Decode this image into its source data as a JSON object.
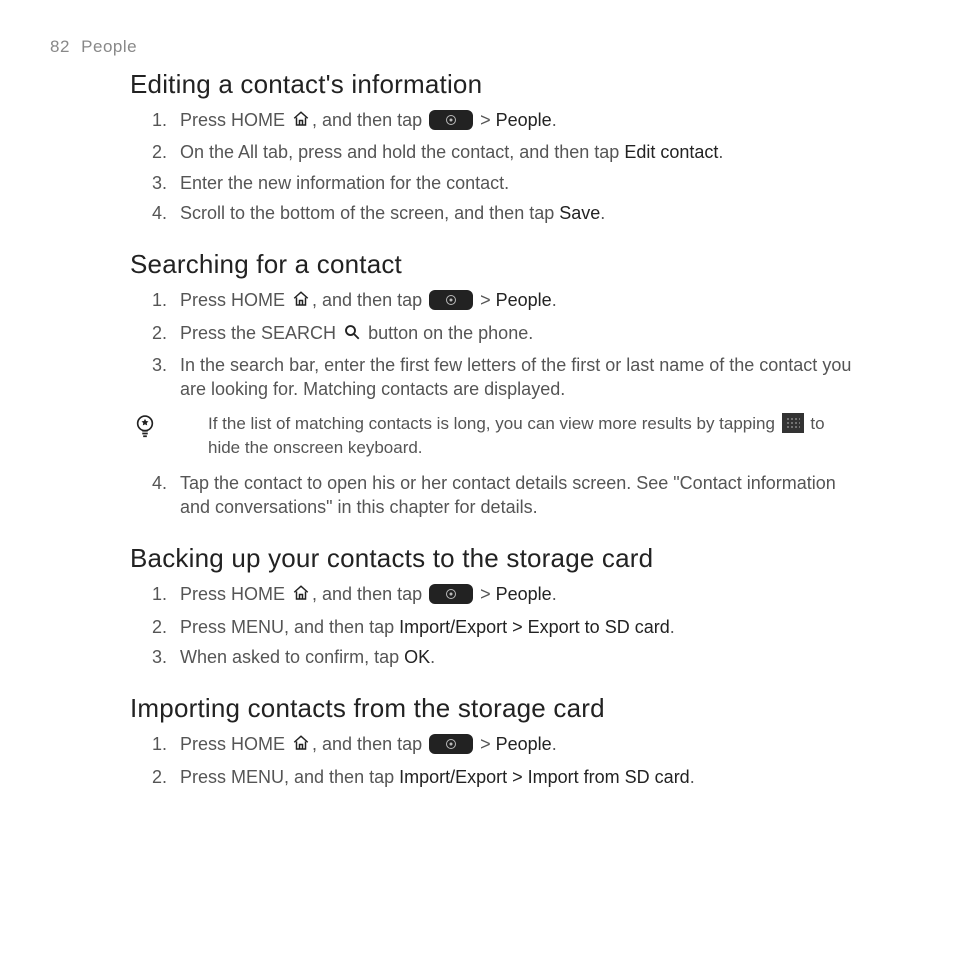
{
  "header": {
    "page_number": "82",
    "chapter": "People"
  },
  "sections": {
    "editing": {
      "title": "Editing a contact's information",
      "steps": {
        "s1a": "Press HOME ",
        "s1b": ", and then tap ",
        "s1c": " > ",
        "s1d": "People",
        "s1e": ".",
        "s2a": "On the All tab, press and hold the contact, and then tap ",
        "s2b": "Edit contact",
        "s2c": ".",
        "s3": "Enter the new information for the contact.",
        "s4a": "Scroll to the bottom of the screen, and then tap ",
        "s4b": "Save",
        "s4c": "."
      }
    },
    "searching": {
      "title": "Searching for a contact",
      "steps": {
        "s1a": "Press HOME ",
        "s1b": ", and then tap ",
        "s1c": " > ",
        "s1d": "People",
        "s1e": ".",
        "s2a": "Press the SEARCH ",
        "s2b": " button on the phone.",
        "s3": "In the search bar, enter the first few letters of the first or last name of the contact you are looking for. Matching contacts are displayed.",
        "s4": "Tap the contact to open his or her contact details screen. See \"Contact information and conversations\" in this chapter for details."
      },
      "tip": {
        "a": "If the list of matching contacts is long, you can view more results by tapping ",
        "b": " to hide the onscreen keyboard."
      }
    },
    "backing_up": {
      "title": "Backing up your contacts to the storage card",
      "steps": {
        "s1a": "Press HOME ",
        "s1b": ", and then tap ",
        "s1c": " > ",
        "s1d": "People",
        "s1e": ".",
        "s2a": "Press MENU, and then tap ",
        "s2b": "Import/Export > Export to SD card",
        "s2c": ".",
        "s3a": "When asked to confirm, tap ",
        "s3b": "OK",
        "s3c": "."
      }
    },
    "importing": {
      "title": "Importing contacts from the storage card",
      "steps": {
        "s1a": "Press HOME ",
        "s1b": ", and then tap ",
        "s1c": " > ",
        "s1d": "People",
        "s1e": ".",
        "s2a": "Press MENU, and then tap ",
        "s2b": "Import/Export > Import from SD card",
        "s2c": "."
      }
    }
  }
}
